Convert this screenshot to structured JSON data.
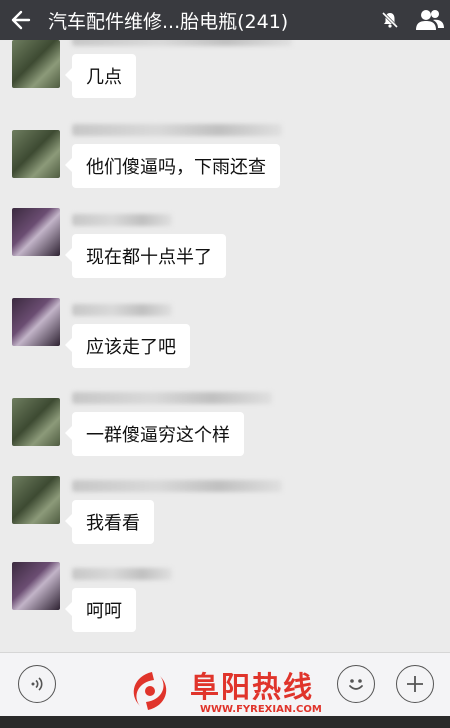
{
  "header": {
    "title": "汽车配件维修...胎电瓶(241)",
    "back_icon": "arrow-left-icon",
    "mute_icon": "bell-off-icon",
    "members_icon": "people-icon"
  },
  "messages": [
    {
      "text": "几点"
    },
    {
      "text": "他们傻逼吗，下雨还查"
    },
    {
      "text": "现在都十点半了"
    },
    {
      "text": "应该走了吧"
    },
    {
      "text": "一群傻逼穷这个样"
    },
    {
      "text": "我看看"
    },
    {
      "text": "呵呵"
    }
  ],
  "inputbar": {
    "voice_icon": "voice-icon",
    "emoji_icon": "emoji-icon",
    "plus_icon": "plus-icon"
  },
  "watermark": {
    "name": "阜阳热线",
    "url": "WWW.FYREXIAN.COM"
  }
}
